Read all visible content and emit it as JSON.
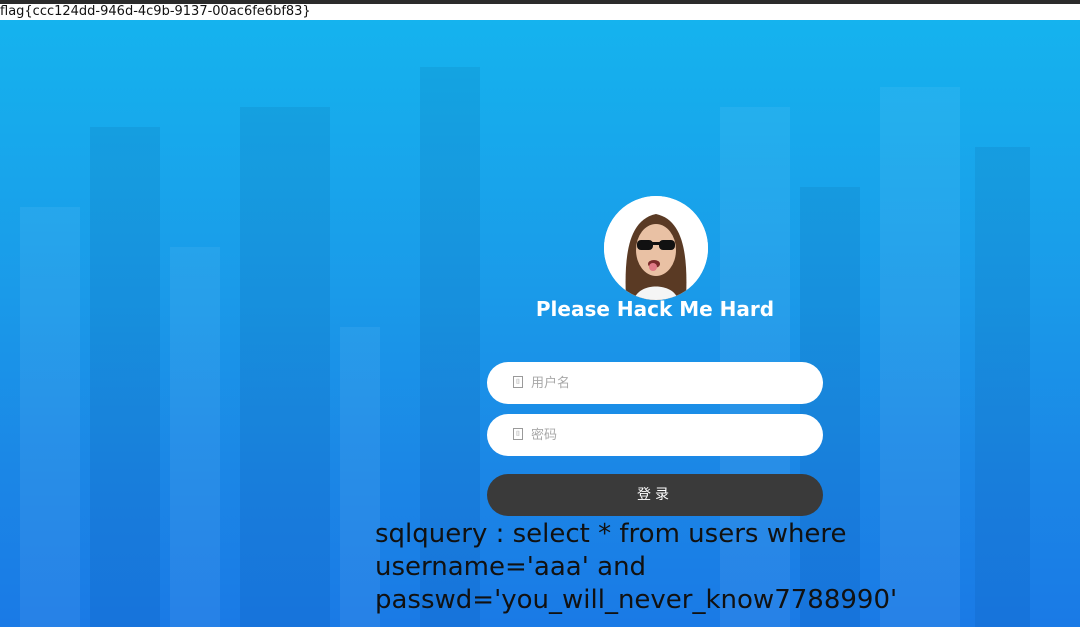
{
  "page": {
    "flag_text": "flag{ccc124dd-946d-4c9b-9137-00ac6fe6bf83}"
  },
  "login": {
    "title": "Please Hack Me Hard",
    "username_placeholder": "用户名",
    "password_placeholder": "密码",
    "submit_label": "登录",
    "avatar_icon": "avatar-photo"
  },
  "debug": {
    "sql_line1": "sqlquery : select * from users where",
    "sql_line2": "username='aaa' and",
    "sql_line3": "passwd='you_will_never_know7788990'"
  },
  "colors": {
    "background_top": "#15b3ee",
    "background_bottom": "#1a7ae6",
    "button": "#3a3a3a"
  }
}
